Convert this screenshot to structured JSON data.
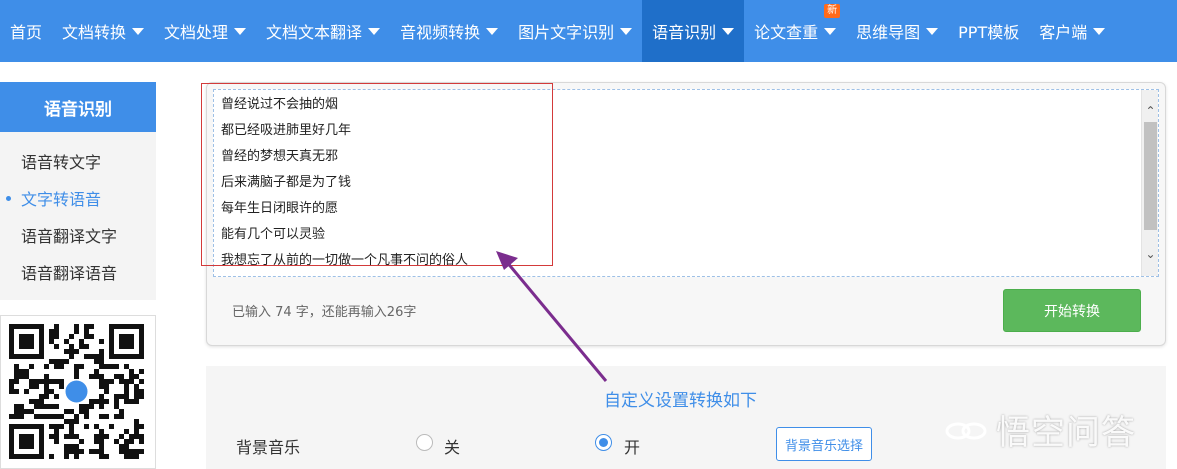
{
  "nav": {
    "items": [
      {
        "label": "首页",
        "caret": false
      },
      {
        "label": "文档转换",
        "caret": true
      },
      {
        "label": "文档处理",
        "caret": true
      },
      {
        "label": "文档文本翻译",
        "caret": true
      },
      {
        "label": "音视频转换",
        "caret": true
      },
      {
        "label": "图片文字识别",
        "caret": true
      },
      {
        "label": "语音识别",
        "caret": true,
        "active": true
      },
      {
        "label": "论文查重",
        "caret": true,
        "badge": "新"
      },
      {
        "label": "思维导图",
        "caret": true
      },
      {
        "label": "PPT模板",
        "caret": false
      },
      {
        "label": "客户端",
        "caret": true
      }
    ]
  },
  "sidebar": {
    "title": "语音识别",
    "items": [
      {
        "label": "语音转文字"
      },
      {
        "label": "文字转语音",
        "active": true
      },
      {
        "label": "语音翻译文字"
      },
      {
        "label": "语音翻译语音"
      }
    ]
  },
  "editor": {
    "lines": [
      "曾经说过不会抽的烟",
      "都已经吸进肺里好几年",
      "曾经的梦想天真无邪",
      "后来满脑子都是为了钱",
      "每年生日闭眼许的愿",
      "能有几个可以灵验",
      "我想忘了从前的一切做一个凡事不问的俗人"
    ],
    "counter": "已输入 74 字，还能再输入26字",
    "start_label": "开始转换"
  },
  "settings": {
    "title": "自定义设置转换如下",
    "bg_music_label": "背景音乐",
    "off_label": "关",
    "on_label": "开",
    "music_select_label": "背景音乐选择",
    "selected": "on"
  },
  "watermark": {
    "text": "悟空问答"
  },
  "colors": {
    "nav_bg": "#3f8ee8",
    "nav_active": "#1f6fc9",
    "accent": "#3f8ee8",
    "start_button": "#5cb85c",
    "highlight": "#d33a3a",
    "arrow": "#7b2d8e",
    "badge": "#ff6a1a"
  }
}
